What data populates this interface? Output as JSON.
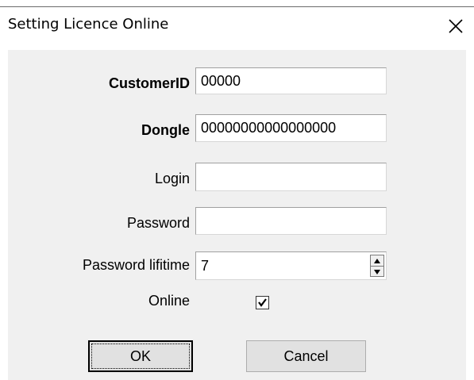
{
  "window": {
    "title": "Setting Licence Online"
  },
  "form": {
    "customer_id": {
      "label": "CustomerID",
      "value": "00000"
    },
    "dongle": {
      "label": "Dongle",
      "value": "00000000000000000"
    },
    "login": {
      "label": "Login",
      "value": ""
    },
    "password": {
      "label": "Password",
      "value": ""
    },
    "password_lifetime": {
      "label": "Password lifitime",
      "value": "7"
    },
    "online": {
      "label": "Online",
      "checked": true
    }
  },
  "buttons": {
    "ok_label": "OK",
    "cancel_label": "Cancel"
  },
  "icons": {
    "close": "close-icon",
    "spin_up": "spin-up-icon",
    "spin_down": "spin-down-icon",
    "check": "checkmark-icon"
  }
}
